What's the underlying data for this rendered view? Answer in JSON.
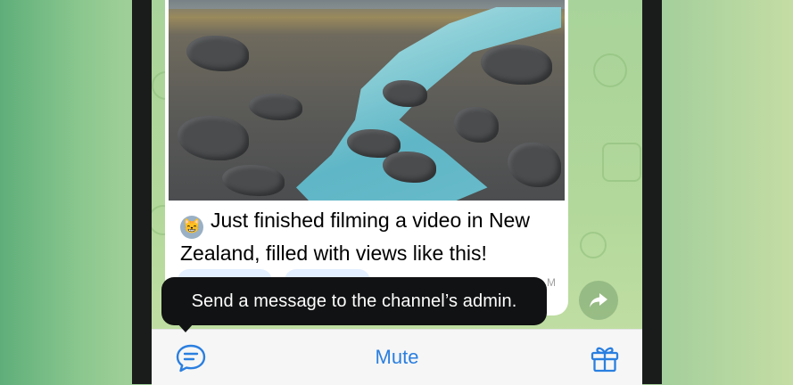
{
  "post": {
    "emoji": "😸",
    "text": "Just finished filming a video in New Zealand, filled with views like this!",
    "time_partial": "M"
  },
  "tooltip": {
    "text": "Send a message to the channel’s admin."
  },
  "bottom_bar": {
    "mute_label": "Mute",
    "left_icon": "message-bubble-icon",
    "right_icon": "gift-icon"
  },
  "colors": {
    "accent": "#2a7fe0",
    "tooltip_bg": "#111213",
    "chat_bg": "#b3d89b"
  }
}
